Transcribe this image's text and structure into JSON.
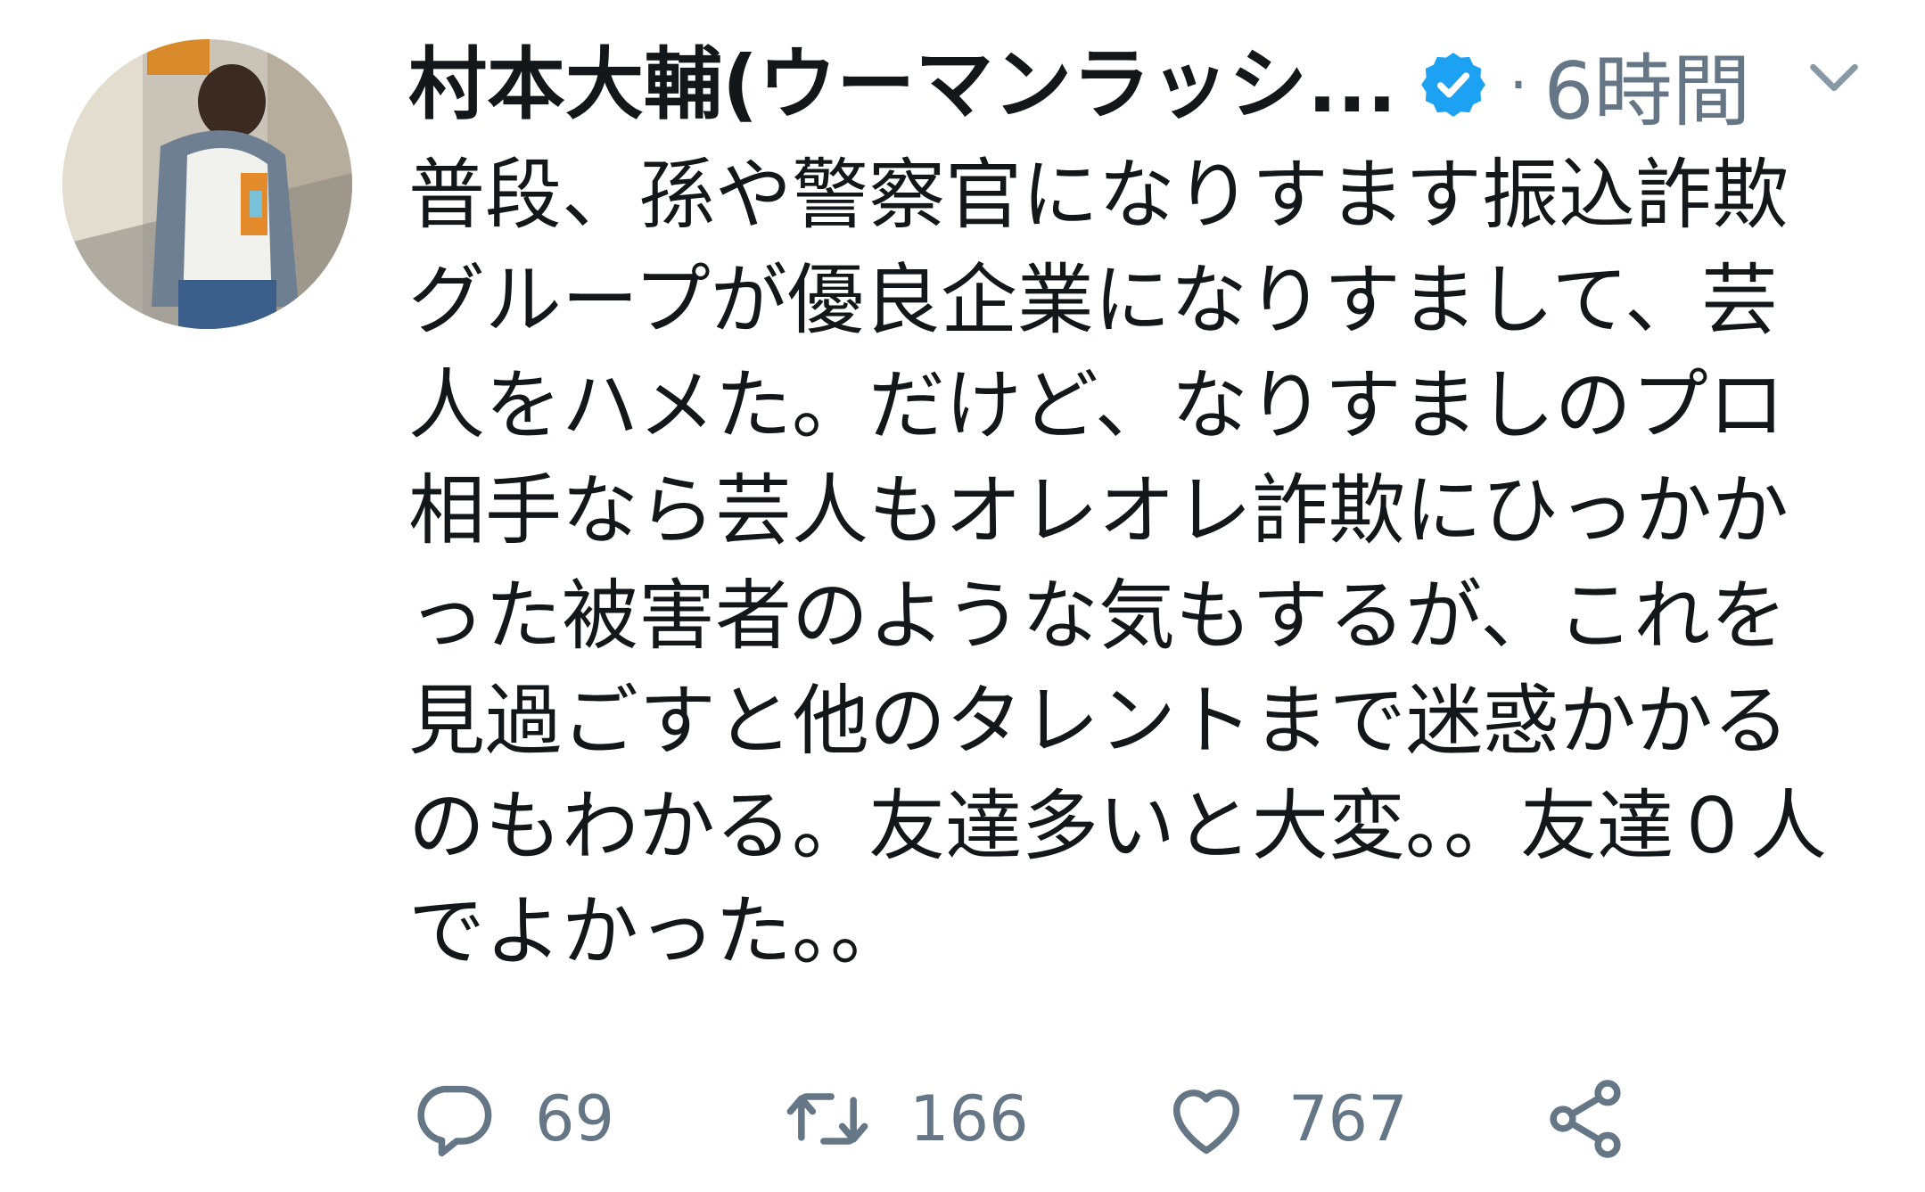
{
  "tweet": {
    "author": {
      "display_name": "村本大輔(ウーマンラッシ...",
      "verified_icon": "verified-badge-icon",
      "avatar": "profile-photo"
    },
    "separator": "·",
    "timestamp": "6時間",
    "menu_icon": "chevron-down-icon",
    "text": "普段、孫や警察官になりすます振込詐欺グループが優良企業になりすまして、芸人をハメた。だけど、なりすましのプロ相手なら芸人もオレオレ詐欺にひっかかった被害者のような気もするが、これを見過ごすと他のタレントまで迷惑かかるのもわかる。友達多いと大変。。友達０人でよかった。。",
    "actions": {
      "reply": {
        "icon": "reply-icon",
        "count": "69"
      },
      "retweet": {
        "icon": "retweet-icon",
        "count": "166"
      },
      "like": {
        "icon": "heart-icon",
        "count": "767"
      },
      "share": {
        "icon": "share-icon"
      }
    }
  },
  "colors": {
    "text": "#14171a",
    "secondary": "#657786",
    "verified_blue": "#1da1f2"
  }
}
